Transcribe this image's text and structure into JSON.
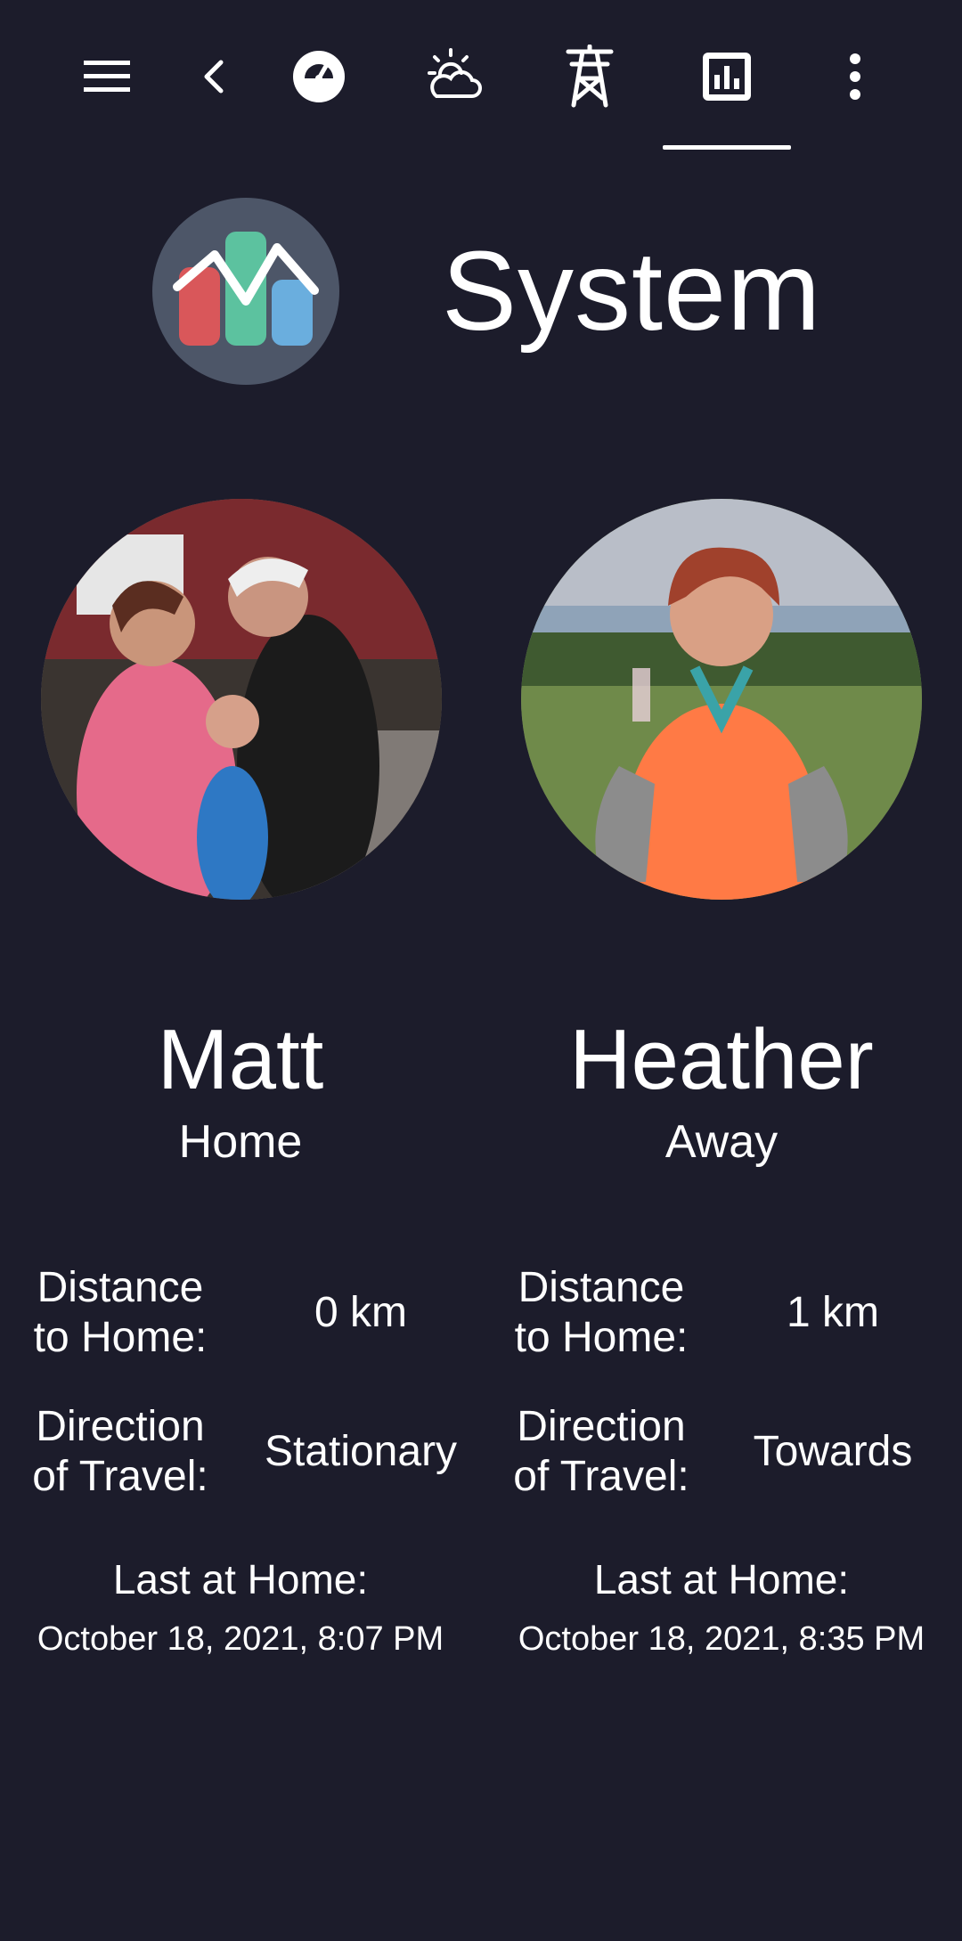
{
  "toolbar": {
    "icons": [
      {
        "name": "menu-icon"
      },
      {
        "name": "back-icon"
      },
      {
        "name": "gauge-icon"
      },
      {
        "name": "weather-icon"
      },
      {
        "name": "power-tower-icon"
      },
      {
        "name": "chart-icon",
        "active": true
      },
      {
        "name": "more-vertical-icon"
      }
    ]
  },
  "header": {
    "title": "System",
    "logo_colors": {
      "background": "#4d5668",
      "red": "#d9575a",
      "green": "#5cc29f",
      "blue": "#6aaede"
    }
  },
  "people": [
    {
      "name": "Matt",
      "status": "Home",
      "distance_label": "Distance to Home:",
      "distance_label_line1": "Distance",
      "distance_label_line2": "to Home:",
      "distance_value": "0 km",
      "direction_label_line1": "Direction",
      "direction_label_line2": "of Travel:",
      "direction_value": "Stationary",
      "last_home_label": "Last at Home:",
      "last_home_value": "October 18, 2021, 8:07 PM"
    },
    {
      "name": "Heather",
      "status": "Away",
      "distance_label_line1": "Distance",
      "distance_label_line2": "to Home:",
      "distance_value": "1 km",
      "direction_label_line1": "Direction",
      "direction_label_line2": "of Travel:",
      "direction_value": "Towards",
      "last_home_label": "Last at Home:",
      "last_home_value": "October 18, 2021, 8:35 PM"
    }
  ],
  "colors": {
    "background": "#1c1c2b",
    "text": "#ffffff"
  }
}
